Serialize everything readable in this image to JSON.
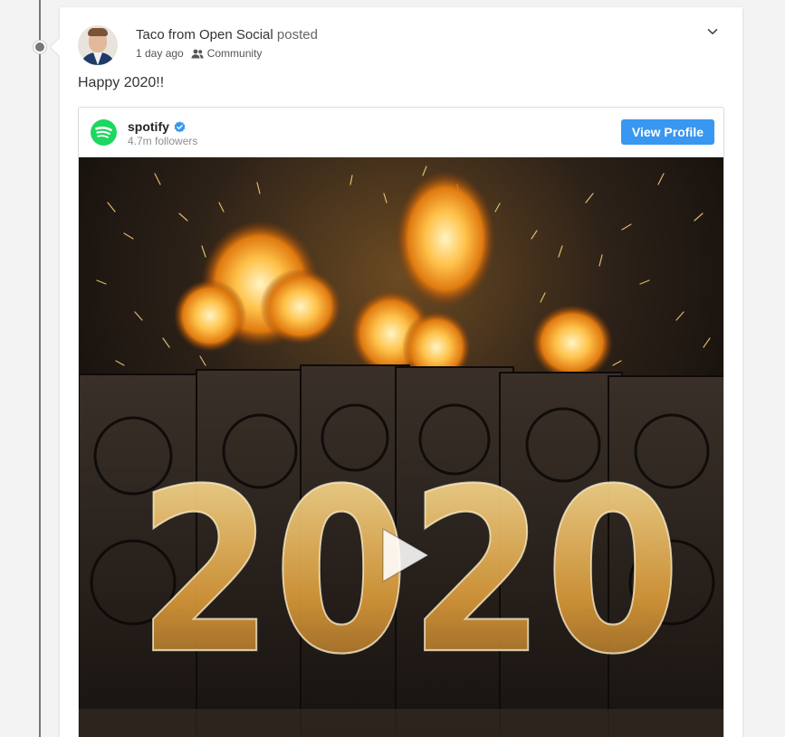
{
  "post": {
    "author_name": "Taco from Open Social",
    "verb": "posted",
    "time_ago": "1 day ago",
    "visibility": "Community",
    "body": "Happy 2020!!"
  },
  "embed": {
    "account_name": "spotify",
    "followers": "4.7m followers",
    "view_profile_label": "View Profile",
    "video_overlay_text": "2020"
  },
  "icons": {
    "dropdown": "chevron-down-icon",
    "visibility": "group-icon",
    "verified": "verified-badge-icon",
    "brand": "spotify-logo-icon",
    "play": "play-icon"
  },
  "colors": {
    "button_blue": "#3897f0",
    "spotify_green": "#1ed760",
    "verified_blue": "#3897f0",
    "timeline_gray": "#777777"
  }
}
